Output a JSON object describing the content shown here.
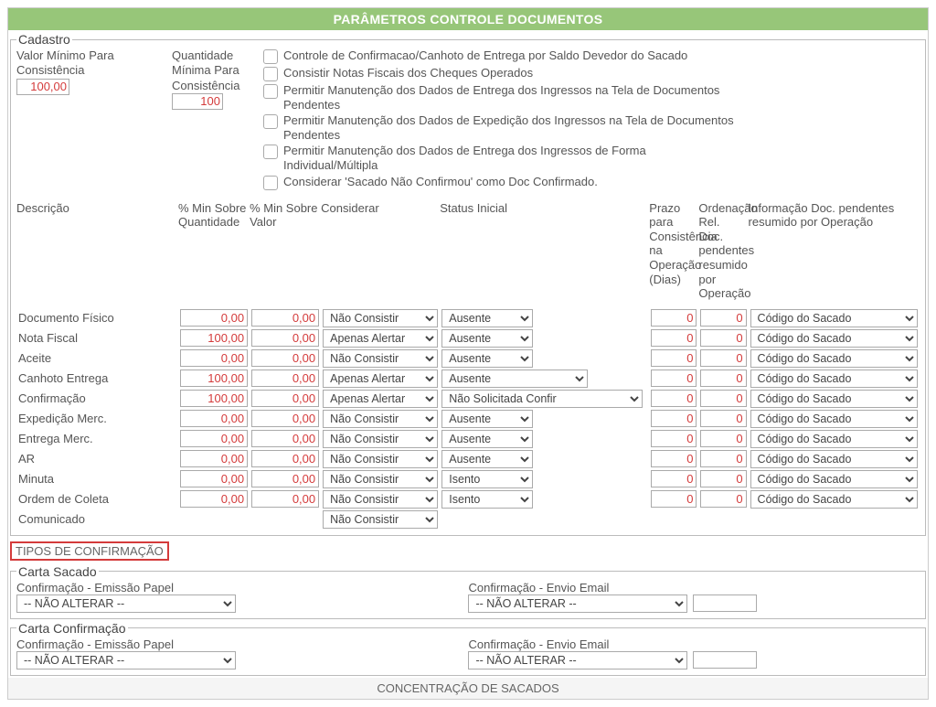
{
  "header": {
    "title": "PARÂMETROS CONTROLE DOCUMENTOS"
  },
  "cadastro": {
    "legend": "Cadastro",
    "valor_min_label": "Valor Mínimo Para\nConsistência",
    "valor_min_value": "100,00",
    "qtd_min_label": "Quantidade\nMínima Para\nConsistência",
    "qtd_min_value": "100",
    "checkboxes": [
      "Controle de Confirmacao/Canhoto de Entrega por Saldo Devedor do Sacado",
      "Consistir Notas Fiscais dos Cheques Operados",
      "Permitir Manutenção dos Dados de Entrega dos Ingressos na Tela de Documentos Pendentes",
      "Permitir Manutenção dos Dados de Expedição dos Ingressos na Tela de Documentos Pendentes",
      "Permitir Manutenção dos Dados de Entrega dos Ingressos de Forma Individual/Múltipla",
      "Considerar 'Sacado Não Confirmou' como Doc Confirmado."
    ]
  },
  "columns": {
    "descricao": "Descrição",
    "pct_qtd": "% Min Sobre Quantidade",
    "pct_valor": "% Min Sobre Valor",
    "considerar": "Considerar",
    "status": "Status Inicial",
    "prazo": "Prazo para Consistência na Operação (Dias)",
    "ordenacao": "Ordenação Rel. Doc. pendentes resumido por Operação",
    "info": "Informação Doc. pendentes resumido por Operação"
  },
  "rows": [
    {
      "label": "Documento Físico",
      "pq": "0,00",
      "pv": "0,00",
      "cons": "Não Consistir",
      "status": "Ausente",
      "status_w": "s",
      "prazo": "0",
      "ord": "0",
      "info": "Código do Sacado"
    },
    {
      "label": "Nota Fiscal",
      "pq": "100,00",
      "pv": "0,00",
      "cons": "Apenas Alertar",
      "status": "Ausente",
      "status_w": "s",
      "prazo": "0",
      "ord": "0",
      "info": "Código do Sacado"
    },
    {
      "label": "Aceite",
      "pq": "0,00",
      "pv": "0,00",
      "cons": "Não Consistir",
      "status": "Ausente",
      "status_w": "s",
      "prazo": "0",
      "ord": "0",
      "info": "Código do Sacado"
    },
    {
      "label": "Canhoto Entrega",
      "pq": "100,00",
      "pv": "0,00",
      "cons": "Apenas Alertar",
      "status": "Ausente",
      "status_w": "m",
      "prazo": "0",
      "ord": "0",
      "info": "Código do Sacado"
    },
    {
      "label": "Confirmação",
      "pq": "100,00",
      "pv": "0,00",
      "cons": "Apenas Alertar",
      "status": "Não Solicitada Confir",
      "status_w": "l",
      "prazo": "0",
      "ord": "0",
      "info": "Código do Sacado"
    },
    {
      "label": "Expedição Merc.",
      "pq": "0,00",
      "pv": "0,00",
      "cons": "Não Consistir",
      "status": "Ausente",
      "status_w": "s",
      "prazo": "0",
      "ord": "0",
      "info": "Código do Sacado"
    },
    {
      "label": "Entrega Merc.",
      "pq": "0,00",
      "pv": "0,00",
      "cons": "Não Consistir",
      "status": "Ausente",
      "status_w": "s",
      "prazo": "0",
      "ord": "0",
      "info": "Código do Sacado"
    },
    {
      "label": "AR",
      "pq": "0,00",
      "pv": "0,00",
      "cons": "Não Consistir",
      "status": "Ausente",
      "status_w": "s",
      "prazo": "0",
      "ord": "0",
      "info": "Código do Sacado"
    },
    {
      "label": "Minuta",
      "pq": "0,00",
      "pv": "0,00",
      "cons": "Não Consistir",
      "status": "Isento",
      "status_w": "s",
      "prazo": "0",
      "ord": "0",
      "info": "Código do Sacado"
    },
    {
      "label": "Ordem de Coleta",
      "pq": "0,00",
      "pv": "0,00",
      "cons": "Não Consistir",
      "status": "Isento",
      "status_w": "s",
      "prazo": "0",
      "ord": "0",
      "info": "Código do Sacado"
    },
    {
      "label": "Comunicado",
      "pq": "",
      "pv": "",
      "cons": "Não Consistir",
      "status": "",
      "status_w": "",
      "prazo": "",
      "ord": "",
      "info": ""
    }
  ],
  "tipos_title": "TIPOS DE CONFIRMAÇÃO",
  "carta_sacado": {
    "legend": "Carta Sacado",
    "emissao_label": "Confirmação - Emissão Papel",
    "emissao_value": "-- NÃO ALTERAR --",
    "envio_label": "Confirmação - Envio Email",
    "envio_value": "-- NÃO ALTERAR --"
  },
  "carta_confirmacao": {
    "legend": "Carta Confirmação",
    "emissao_label": "Confirmação - Emissão Papel",
    "emissao_value": "-- NÃO ALTERAR --",
    "envio_label": "Confirmação - Envio Email",
    "envio_value": "-- NÃO ALTERAR --"
  },
  "footer": {
    "title": "CONCENTRAÇÃO DE SACADOS"
  }
}
